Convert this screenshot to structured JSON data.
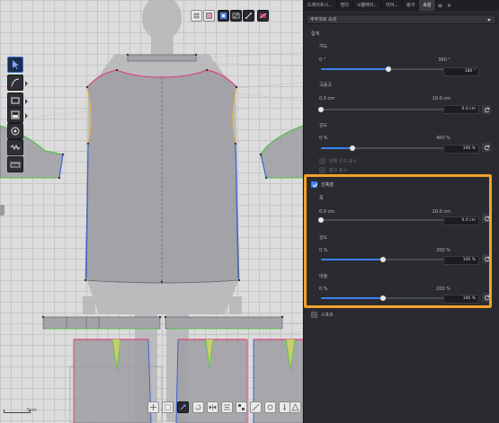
{
  "tabs": [
    {
      "label": "드레이프시..."
    },
    {
      "label": "편다"
    },
    {
      "label": "시뮬레이..."
    },
    {
      "label": "아이..."
    },
    {
      "label": "링크"
    },
    {
      "label": "속성"
    }
  ],
  "panel": {
    "header": "주부코로 속성",
    "section_title": "합계",
    "angle": {
      "label": "각도",
      "min": "0 °",
      "max": "360 °",
      "value": "180 °",
      "fraction": 0.5
    },
    "curvature": {
      "label": "곡률곡",
      "min": "0.0 cm",
      "max": "10.0 cm",
      "value": "0.0 cm",
      "fraction": 0.0
    },
    "strength": {
      "label": "강도",
      "min": "0 %",
      "max": "400 %",
      "value": "100 %",
      "fraction": 0.25
    },
    "check_a": "대체 위치 표시",
    "check_b": "참고 표시",
    "stretch": {
      "label": "신축성",
      "checked": true,
      "width": {
        "label": "폭",
        "min": "0.0 cm",
        "max": "10.0 cm",
        "value": "0.0 cm",
        "fraction": 0.0
      },
      "strength": {
        "label": "강도",
        "min": "0 %",
        "max": "200 %",
        "value": "100 %",
        "fraction": 0.5
      },
      "ratio": {
        "label": "비율",
        "min": "0 %",
        "max": "200 %",
        "value": "100 %",
        "fraction": 0.5
      }
    },
    "stitch": {
      "label": "스포트",
      "checked": false
    }
  },
  "canvas": {
    "scale_label": "5cm"
  },
  "colors": {
    "accent": "#3d7ff0",
    "highlight": "#f3a12a",
    "pattern_fill": "#9e9ea3",
    "seam_green": "#56c24a",
    "seam_blue": "#3f64d8",
    "seam_red": "#e0417a"
  },
  "icons": {
    "left_toolbar": [
      "select-arrow-icon",
      "pen-curve-icon",
      "rectangle-icon",
      "segment-icon",
      "circle-icon",
      "zigzag-icon",
      "ruler-icon"
    ],
    "top_toolbar": [
      "grid-icon",
      "layer-icon",
      "avatar-icon",
      "sync-icon",
      "bone-icon",
      "view-icon"
    ],
    "bottom_toolbar": [
      "move-icon",
      "select-icon",
      "transform-icon",
      "rotate-icon",
      "flip-icon",
      "align-icon",
      "arrange-icon",
      "measure-icon",
      "snap-icon",
      "pin-icon",
      "fold-icon"
    ]
  }
}
